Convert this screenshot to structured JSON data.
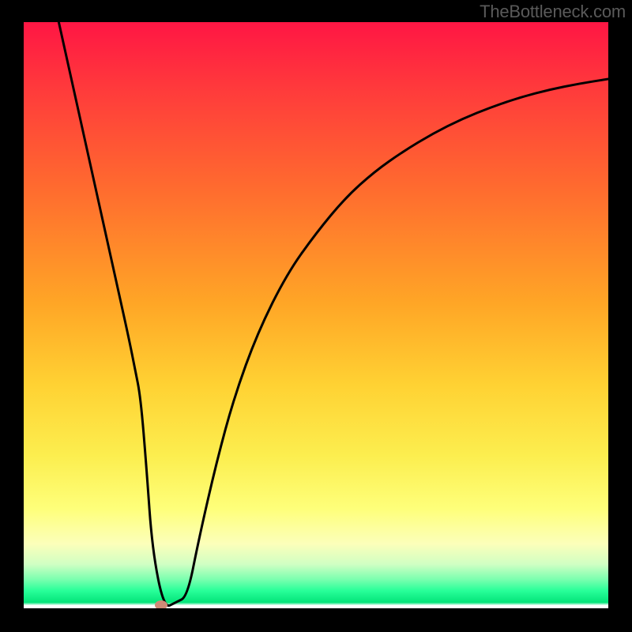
{
  "watermark": "TheBottleneck.com",
  "colors": {
    "frame": "#000000",
    "curve": "#000000",
    "marker": "#cf8a77"
  },
  "chart_data": {
    "type": "line",
    "title": "",
    "xlabel": "",
    "ylabel": "",
    "xlim": [
      0,
      100
    ],
    "ylim": [
      0,
      100
    ],
    "grid": false,
    "legend": false,
    "series": [
      {
        "name": "bottleneck-curve",
        "x": [
          6,
          8,
          10,
          12,
          14,
          16,
          18,
          19,
          20,
          21,
          22,
          24,
          26,
          28,
          30,
          33,
          36,
          40,
          45,
          50,
          55,
          60,
          65,
          70,
          75,
          80,
          85,
          90,
          95,
          100
        ],
        "y": [
          100,
          91,
          82,
          73,
          64,
          55,
          46,
          41,
          36,
          24,
          10,
          0,
          1,
          2,
          12,
          25,
          36,
          47,
          57,
          64,
          70,
          74.5,
          78,
          81,
          83.5,
          85.5,
          87.2,
          88.5,
          89.5,
          90.3
        ]
      }
    ],
    "marker": {
      "x": 23.5,
      "y": 0.5
    },
    "gradient_stops": [
      {
        "pos": 0,
        "color": "#ff1644"
      },
      {
        "pos": 0.12,
        "color": "#ff3c3b"
      },
      {
        "pos": 0.28,
        "color": "#ff6a2f"
      },
      {
        "pos": 0.48,
        "color": "#ffa626"
      },
      {
        "pos": 0.62,
        "color": "#ffd233"
      },
      {
        "pos": 0.74,
        "color": "#fcee4f"
      },
      {
        "pos": 0.83,
        "color": "#feff7a"
      },
      {
        "pos": 0.89,
        "color": "#fcffba"
      },
      {
        "pos": 0.925,
        "color": "#d0ffc3"
      },
      {
        "pos": 0.95,
        "color": "#7dffb0"
      },
      {
        "pos": 0.97,
        "color": "#28ff99"
      },
      {
        "pos": 0.99,
        "color": "#04e47a"
      },
      {
        "pos": 1.0,
        "color": "#ffffff"
      }
    ]
  }
}
